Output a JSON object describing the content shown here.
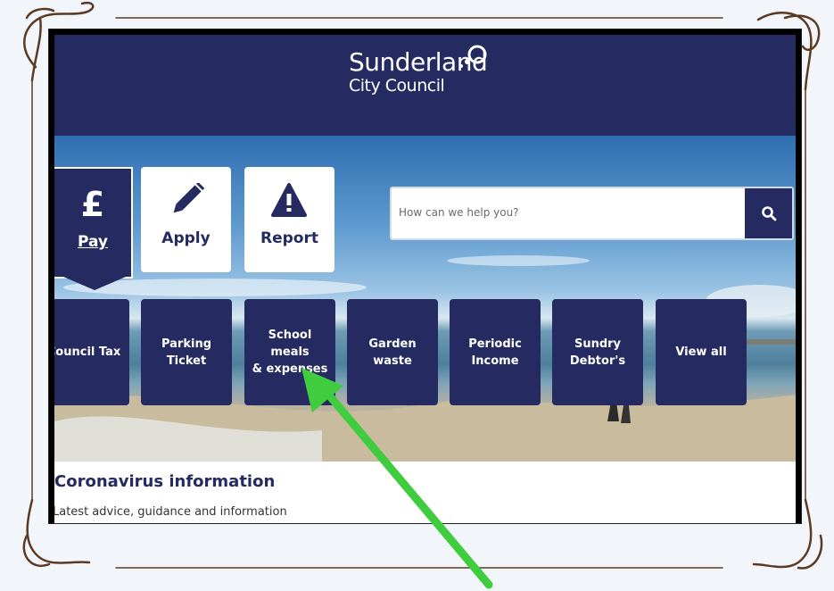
{
  "header": {
    "logo_line1": "Sunderland",
    "logo_line2": "City Council"
  },
  "quick_actions": [
    {
      "label": "Pay",
      "icon": "pound-icon"
    },
    {
      "label": "Apply",
      "icon": "pencil-icon"
    },
    {
      "label": "Report",
      "icon": "warning-icon"
    }
  ],
  "pay_symbol": "£",
  "search": {
    "placeholder": "How can we help you?",
    "icon": "search-icon"
  },
  "tiles": [
    {
      "label": "Council Tax"
    },
    {
      "label": "Parking\nTicket"
    },
    {
      "label": "School meals\n& expenses"
    },
    {
      "label": "Garden\nwaste"
    },
    {
      "label": "Periodic\nIncome"
    },
    {
      "label": "Sundry\nDebtor's"
    },
    {
      "label": "View all"
    }
  ],
  "coronavirus": {
    "title": "Coronavirus information",
    "subtitle": "Latest advice, guidance and information"
  },
  "colors": {
    "brand_navy": "#252a60",
    "annotation_arrow": "#3fcc3f",
    "frame_brown": "#5a3a22"
  }
}
